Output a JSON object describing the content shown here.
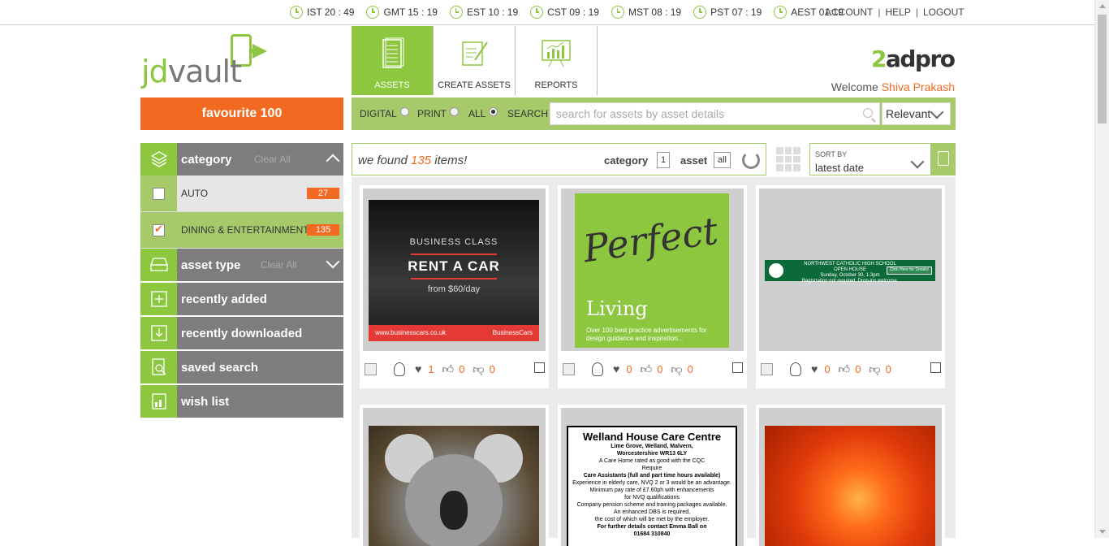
{
  "clocks": [
    {
      "label": "IST 20 : 49"
    },
    {
      "label": "GMT 15 : 19"
    },
    {
      "label": "EST 10 : 19"
    },
    {
      "label": "CST 09 : 19"
    },
    {
      "label": "MST 08 : 19"
    },
    {
      "label": "PST 07 : 19"
    },
    {
      "label": "AEST 01:19"
    }
  ],
  "account_links": {
    "account": "ACCOUNT",
    "help": "HELP",
    "logout": "LOGOUT",
    "sep": "|"
  },
  "logo": {
    "jd": "jd",
    "vault": "vault"
  },
  "nav": {
    "tabs": [
      {
        "label": "ASSETS",
        "icon": "document-list-icon"
      },
      {
        "label": "CREATE ASSETS",
        "icon": "edit-document-icon"
      },
      {
        "label": "REPORTS",
        "icon": "chart-board-icon"
      }
    ]
  },
  "brand": {
    "prefix": "2",
    "name": "adpro"
  },
  "welcome": {
    "text": "Welcome",
    "user": "Shiva Prakash"
  },
  "favourite_button": "favourite 100",
  "search": {
    "options": [
      {
        "label": "DIGITAL",
        "selected": false
      },
      {
        "label": "PRINT",
        "selected": false
      },
      {
        "label": "ALL",
        "selected": true
      }
    ],
    "search_label": "SEARCH",
    "placeholder": "search for assets by asset details",
    "sort_select": "Relevant"
  },
  "sidebar": {
    "category": {
      "label": "category",
      "clear": "Clear All"
    },
    "category_items": [
      {
        "label": "AUTO",
        "count": "27",
        "checked": false
      },
      {
        "label": "DINING & ENTERTAINMENT",
        "count": "135",
        "checked": true
      }
    ],
    "asset_type": {
      "label": "asset type",
      "clear": "Clear All"
    },
    "items": [
      {
        "label": "recently added",
        "icon": "plus-square-icon"
      },
      {
        "label": "recently downloaded",
        "icon": "download-icon"
      },
      {
        "label": "saved search",
        "icon": "search-document-icon"
      },
      {
        "label": "wish list",
        "icon": "wish-list-icon"
      }
    ]
  },
  "results": {
    "prefix": "we found ",
    "count": "135",
    "suffix": " items!",
    "category_label": "category",
    "category_value": "1",
    "asset_label": "asset",
    "asset_value": "all"
  },
  "sort": {
    "label": "SORT BY",
    "value": "latest date"
  },
  "cards": [
    {
      "likes": "1",
      "thumbs_up": "0",
      "thumbs_down": "0",
      "ad": {
        "line1": "BUSINESS CLASS",
        "line2": "RENT A CAR",
        "line3": "from $60/day",
        "footer_url": "www.businesscars.co.uk",
        "footer_brand": "BusinessCars"
      }
    },
    {
      "likes": "0",
      "thumbs_up": "0",
      "thumbs_down": "0",
      "ad": {
        "title": "Perfect",
        "title2": "Living",
        "subtitle": "Over 100 best practice advertisements for design guidance and inspiration..."
      }
    },
    {
      "likes": "0",
      "thumbs_up": "0",
      "thumbs_down": "0",
      "ad": {
        "line1": "NORTHWEST CATHOLIC HIGH SCHOOL",
        "line2": "OPEN HOUSE",
        "line3": "Sunday, October 30, 1-3pm",
        "line4": "Registration not required. Drop-ins welcome.",
        "button": "Click Here for Details!"
      }
    },
    {
      "ad": {}
    },
    {
      "ad": {
        "title": "Welland House Care Centre",
        "lines": [
          "Lime Grove, Welland, Malvern,",
          "Worcestershire WR13 6LY",
          "A Care Home rated as good with the CQC",
          "Require",
          "Care Assistants (full and part time hours available)",
          "Experience in elderly care, NVQ 2 or 3 would be an advantage.",
          "Minimum pay rate of £7.60ph with enhancements",
          "for NVQ qualifications",
          "Company pension scheme and training packages available.",
          "An enhanced DBS is required,",
          "the cost of which will be met by the employer.",
          "For further details contact Emma Ball on",
          "01684 310840"
        ]
      }
    },
    {
      "ad": {}
    }
  ],
  "colors": {
    "accent_green": "#8dc63f",
    "light_green": "#a6c96a",
    "orange": "#f26a21",
    "grey": "#7d7d7d"
  }
}
